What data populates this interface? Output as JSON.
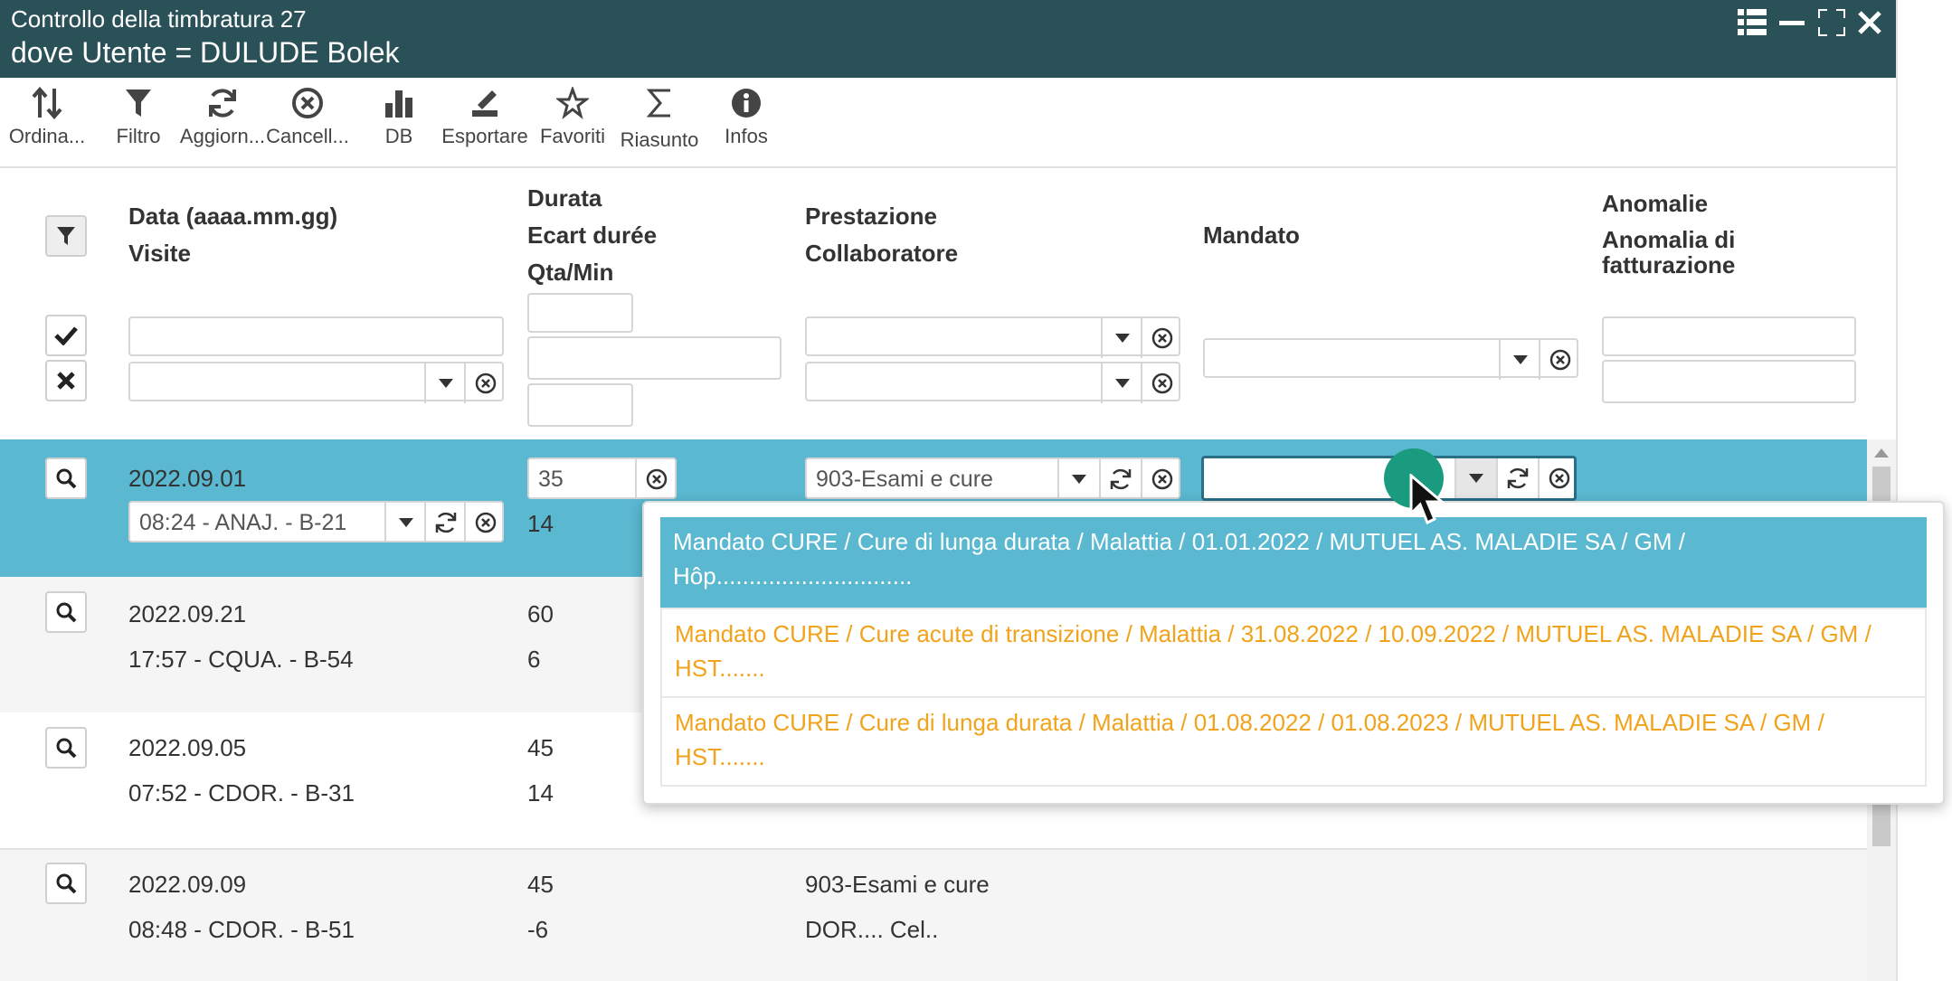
{
  "window": {
    "title": "Controllo della timbratura 27",
    "subtitle": "dove Utente = DULUDE Bolek"
  },
  "toolbar": [
    {
      "label": "Ordina...",
      "icon": "sort-icon"
    },
    {
      "label": "Filtro",
      "icon": "filter-icon"
    },
    {
      "label": "Aggiorn...",
      "icon": "refresh-icon"
    },
    {
      "label": "Cancell...",
      "icon": "cancel-icon"
    },
    {
      "label": "DB",
      "icon": "bar-chart-icon"
    },
    {
      "label": "Esportare",
      "icon": "export-icon"
    },
    {
      "label": "Favoriti",
      "icon": "star-icon"
    },
    {
      "label": "Riasunto",
      "icon": "sigma-icon"
    },
    {
      "label": "Infos",
      "icon": "info-icon"
    }
  ],
  "headers": {
    "col1_a": "Data (aaaa.mm.gg)",
    "col1_b": "Visite",
    "col2_a": "Durata",
    "col2_b": "Ecart durée",
    "col2_c": "Qta/Min",
    "col3_a": "Prestazione",
    "col3_b": "Collaboratore",
    "col4": "Mandato",
    "col5_a": "Anomalie",
    "col5_b": "Anomalia di fatturazione"
  },
  "rows": [
    {
      "date": "2022.09.01",
      "visit": "08:24 - ANAJ. - B-21",
      "dur": "35",
      "ecart": "14",
      "prest": "903-Esami e cure",
      "collab": "",
      "selected": true
    },
    {
      "date": "2022.09.21",
      "visit": "17:57 - CQUA. - B-54",
      "dur": "60",
      "ecart": "6",
      "prest": "",
      "collab": ""
    },
    {
      "date": "2022.09.05",
      "visit": "07:52 - CDOR. - B-31",
      "dur": "45",
      "ecart": "14",
      "prest": "",
      "collab": ""
    },
    {
      "date": "2022.09.09",
      "visit": "08:48 - CDOR. - B-51",
      "dur": "45",
      "ecart": "-6",
      "prest": "903-Esami e cure",
      "collab": "DOR.... Cel.."
    }
  ],
  "dropdown": {
    "options": [
      {
        "line1": "Mandato CURE / Cure di lunga durata / Malattia / 01.01.2022 / MUTUEL AS. MALADIE SA / GM /",
        "line2": "Hôp..............................",
        "active": true
      },
      {
        "line1": "Mandato CURE / Cure acute di transizione / Malattia / 31.08.2022 / 10.09.2022 / MUTUEL AS. MALADIE SA / GM /",
        "line2": "HST......."
      },
      {
        "line1": "Mandato CURE / Cure di lunga durata / Malattia / 01.08.2022 / 01.08.2023 / MUTUEL AS. MALADIE SA / GM /",
        "line2": "HST......."
      }
    ]
  },
  "colors": {
    "titlebar": "#2a5058",
    "selected_row": "#5ab8d0",
    "option_text": "#f0a31b",
    "cursor_dot": "#1a9a7e"
  }
}
